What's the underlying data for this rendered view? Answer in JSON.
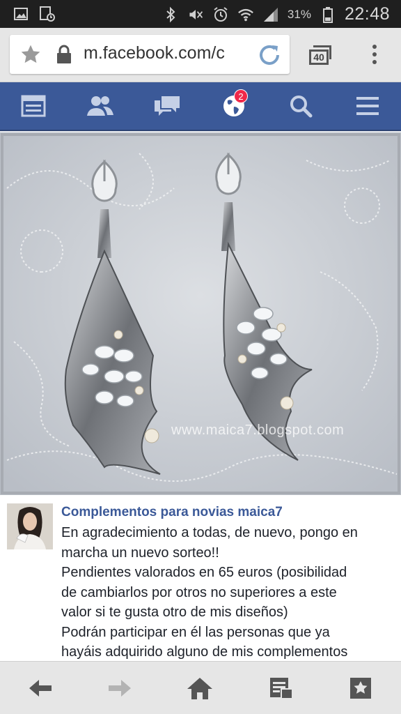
{
  "status_bar": {
    "icons": [
      "image-icon",
      "screenshot-icon",
      "bluetooth-icon",
      "mute-icon",
      "alarm-icon",
      "wifi-icon",
      "signal-icon"
    ],
    "battery_percent": "31%",
    "time": "22:48"
  },
  "browser": {
    "url": "m.facebook.com/c",
    "tab_count": "40",
    "icons": [
      "bookmark-star-icon",
      "lock-icon",
      "reload-icon",
      "tabs-icon",
      "menu-dots-icon"
    ]
  },
  "fb_nav": {
    "items": [
      {
        "name": "news-feed-icon"
      },
      {
        "name": "friends-icon"
      },
      {
        "name": "messages-icon"
      },
      {
        "name": "notifications-globe-icon",
        "badge": "2"
      },
      {
        "name": "search-icon"
      },
      {
        "name": "menu-icon"
      }
    ],
    "color": "#3b5998",
    "badge_color": "#f02849"
  },
  "photo": {
    "watermark": "www.maica7.blogspot.com"
  },
  "post": {
    "author": "Complementos para novias maica7",
    "lines": [
      "En agradecimiento a todas, de nuevo, pongo en",
      "marcha un nuevo sorteo!!",
      "Pendientes valorados en 65 euros (posibilidad",
      "de cambiarlos por otros no superiores a este",
      "valor si te gusta otro de mis diseños)",
      "Podrán participar en él las personas que ya",
      "hayáis adquirido alguno de mis complementos"
    ]
  },
  "bottom_bar": {
    "items": [
      "back-arrow-icon",
      "forward-arrow-icon",
      "home-icon",
      "saved-pages-icon",
      "bookmarks-icon"
    ]
  }
}
